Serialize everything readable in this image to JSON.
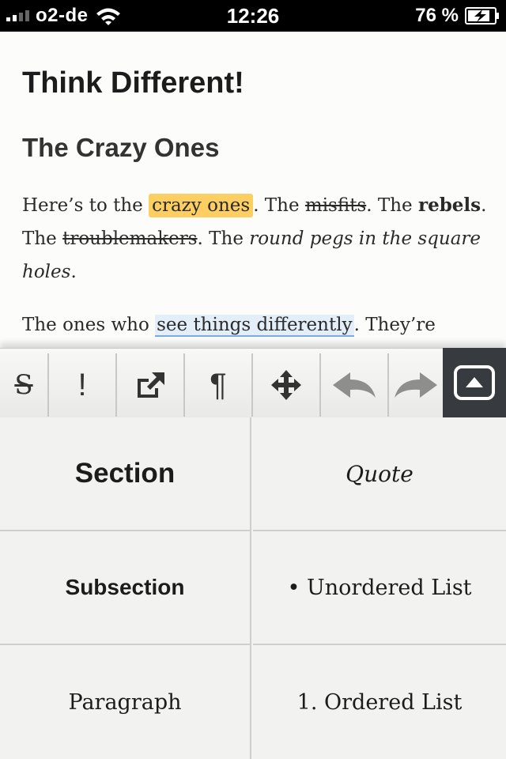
{
  "status_bar": {
    "carrier": "o2-de",
    "time": "12:26",
    "battery_percent": "76 %",
    "battery_level": 0.76,
    "signal_bars": 2,
    "icons": [
      "signal-bars-icon",
      "wifi-icon",
      "battery-charging-icon"
    ]
  },
  "document": {
    "title": "Think Different!",
    "subtitle": "The Crazy Ones",
    "paragraph1": {
      "t1": "Here’s to the ",
      "highlight": "crazy ones",
      "t2": ". The ",
      "strike1": "misfits",
      "t3": ". The ",
      "bold": "rebels",
      "t4": ". The ",
      "strike2": "troublemakers",
      "t5": ". The ",
      "italic": "round pegs in the square holes",
      "t6": "."
    },
    "paragraph2": {
      "t1": "The ones who ",
      "link": "see things differently",
      "t2": ". They’re"
    },
    "highlight_color": "#fdce62",
    "link_underline_color": "#79aee3"
  },
  "toolbar": {
    "strikethrough_label": "S",
    "emphasis_label": "!",
    "paragraph_label": "¶",
    "icons": [
      "strikethrough-icon",
      "exclamation-icon",
      "external-link-icon",
      "pilcrow-icon",
      "move-arrows-icon",
      "undo-icon",
      "redo-icon",
      "eject-keyboard-icon"
    ]
  },
  "styles": {
    "section": "Section",
    "quote": "Quote",
    "subsection": "Subsection",
    "unordered_list": "• Unordered List",
    "paragraph": "Paragraph",
    "ordered_list": "1. Ordered List"
  }
}
